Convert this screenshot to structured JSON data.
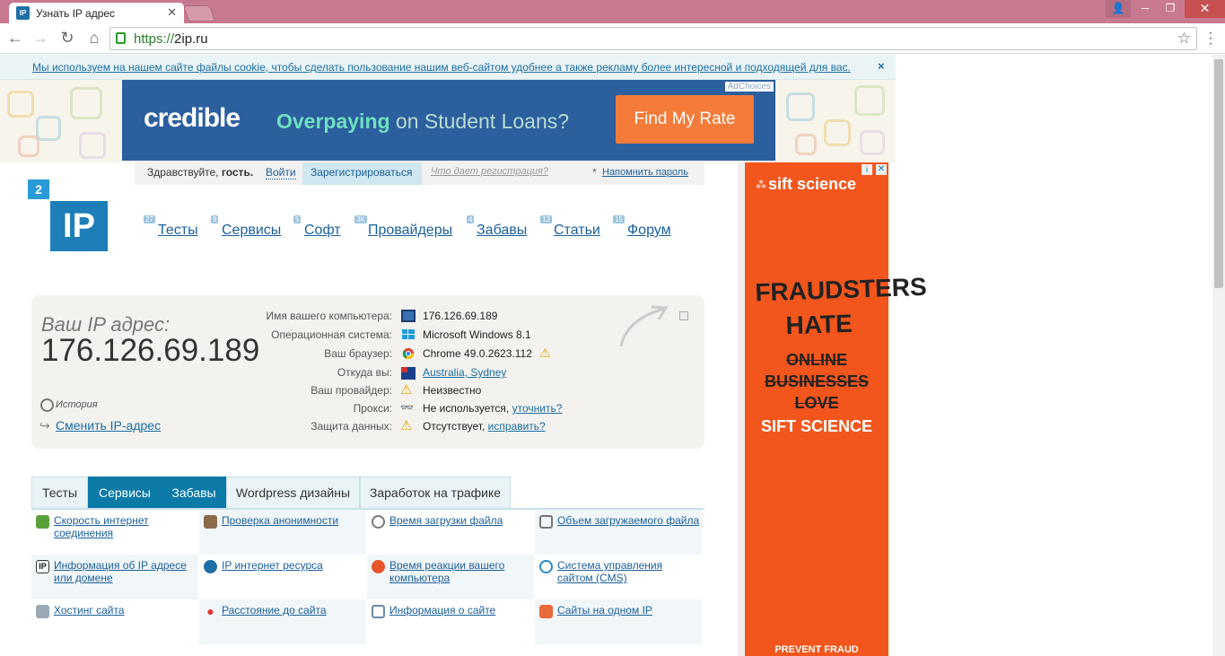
{
  "browser": {
    "tab_title": "Узнать IP адрес",
    "tab_favicon": "IP",
    "url_scheme": "https://",
    "url_host": "2ip.ru"
  },
  "cookie_notice": {
    "text": "Мы используем на нашем сайте файлы cookie, чтобы сделать пользование нашим веб-сайтом удобнее а также рекламу более интересной и подходящей для вас.",
    "close": "×"
  },
  "top_ad": {
    "adchoices": "AdChoices",
    "brand": "credible",
    "tagline_bold": "Overpaying",
    "tagline_rest": " on Student Loans?",
    "cta": "Find My Rate"
  },
  "auth": {
    "greeting": "Здравствуйте,",
    "guest": "гость.",
    "login": "Войти",
    "register": "Зарегистрироваться",
    "why_register": "Что дает регистрация?",
    "asterisk": "*",
    "remind": "Напомнить пароль"
  },
  "logo": {
    "small": "2",
    "big": "IP"
  },
  "menu": [
    {
      "label": "Тесты",
      "badge": "27"
    },
    {
      "label": "Сервисы",
      "badge": "9"
    },
    {
      "label": "Софт",
      "badge": "5"
    },
    {
      "label": "Провайдеры",
      "badge": "3K"
    },
    {
      "label": "Забавы",
      "badge": "4"
    },
    {
      "label": "Статьи",
      "badge": "13"
    },
    {
      "label": "Форум",
      "badge": "15"
    }
  ],
  "ip_info": {
    "label": "Ваш IP адрес:",
    "ip": "176.126.69.189",
    "history": "История",
    "change_ip": "Сменить IP-адрес",
    "rows": [
      {
        "key": "Имя вашего компьютера:",
        "value": "176.126.69.189",
        "icon": "computer-icon"
      },
      {
        "key": "Операционная система:",
        "value": "Microsoft Windows 8.1",
        "icon": "windows-icon"
      },
      {
        "key": "Ваш браузер:",
        "value": "Chrome 49.0.2623.112",
        "icon": "chrome-icon"
      },
      {
        "key": "Откуда вы:",
        "value": "Australia, Sydney",
        "icon": "australia-flag-icon"
      },
      {
        "key": "Ваш провайдер:",
        "value": "Неизвестно",
        "icon": "warning-icon"
      },
      {
        "key": "Прокси:",
        "value": "Не используется,",
        "link": "уточнить?",
        "icon": "glasses-icon"
      },
      {
        "key": "Защита данных:",
        "value": "Отсутствует,",
        "link": "исправить?",
        "icon": "warning-icon"
      }
    ]
  },
  "tabs": [
    "Тесты",
    "Сервисы",
    "Забавы",
    "Wordpress дизайны",
    "Заработок на трафике"
  ],
  "services": [
    [
      "Скорость интернет соединения",
      "Проверка анонимности",
      "Время загрузки файла",
      "Объем загружаемого файла"
    ],
    [
      "Информация об IP адресе или домене",
      "IP интернет ресурса",
      "Время реакции вашего компьютера",
      "Система управления сайтом (CMS)"
    ],
    [
      "Хостинг сайта",
      "Расстояние до сайта",
      "Информация о сайте",
      "Сайты на одном IP"
    ]
  ],
  "side_ad": {
    "brand": "sift science",
    "headline": "FRAUDSTERS HATE",
    "struck": [
      "ONLINE",
      "BUSINESSES",
      "LOVE"
    ],
    "sift": "SIFT SCIENCE",
    "footer": "PREVENT FRAUD"
  },
  "colors": {
    "accent": "#0b7aa6",
    "link": "#1b6da2",
    "titlebar": "#c8798f",
    "ad_orange": "#f2561d"
  }
}
